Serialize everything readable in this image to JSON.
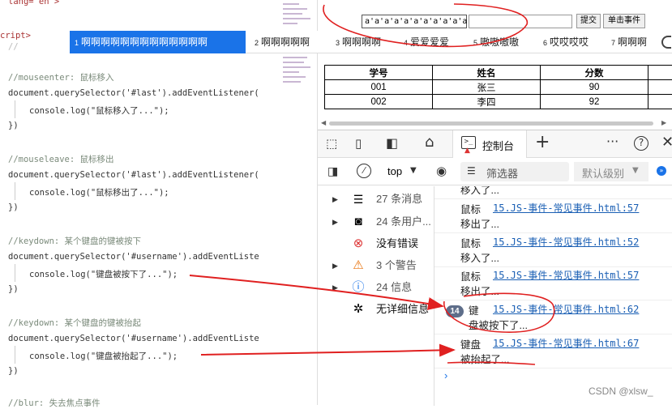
{
  "editor": {
    "lines": [
      {
        "text": "lang=\"en\">",
        "kind": "code"
      },
      {
        "text": "cript>",
        "kind": "tag"
      },
      {
        "text": "//mouseenter: 鼠标移入",
        "kind": "comment"
      },
      {
        "text": "document.querySelector('#last').addEventListener(",
        "kind": "code"
      },
      {
        "text": "console.log(\"鼠标移入了...\");",
        "kind": "code"
      },
      {
        "text": "})",
        "kind": "code"
      },
      {
        "text": "//mouseleave: 鼠标移出",
        "kind": "comment"
      },
      {
        "text": "document.querySelector('#last').addEventListener(",
        "kind": "code"
      },
      {
        "text": "console.log(\"鼠标移出了...\");",
        "kind": "code"
      },
      {
        "text": "})",
        "kind": "code"
      },
      {
        "text": "//keydown: 某个键盘的键被按下",
        "kind": "comment"
      },
      {
        "text": "document.querySelector('#username').addEventListe",
        "kind": "code"
      },
      {
        "text": "console.log(\"键盘被按下了...\");",
        "kind": "code"
      },
      {
        "text": "})",
        "kind": "code"
      },
      {
        "text": "//keydown: 某个键盘的键被抬起",
        "kind": "comment"
      },
      {
        "text": "document.querySelector('#username').addEventListe",
        "kind": "code"
      },
      {
        "text": "console.log(\"键盘被抬起了...\");",
        "kind": "code"
      },
      {
        "text": "})",
        "kind": "code"
      },
      {
        "text": "//blur: 失去焦点事件",
        "kind": "comment"
      }
    ]
  },
  "browser": {
    "input_value": "a'a'a'a'a'a'a'a'a'a'a'a'a'a",
    "submit_label": "提交",
    "click_label": "单击事件",
    "tabs": [
      {
        "num": "1",
        "label": "啊啊啊啊啊啊啊啊啊啊啊啊啊"
      },
      {
        "num": "2",
        "label": "啊啊啊啊啊"
      },
      {
        "num": "3",
        "label": "啊啊啊啊"
      },
      {
        "num": "4",
        "label": "爱爱爱爱"
      },
      {
        "num": "5",
        "label": "嗷嗷嗷嗷"
      },
      {
        "num": "6",
        "label": "哎哎哎哎"
      },
      {
        "num": "7",
        "label": "啊啊啊"
      }
    ],
    "table": {
      "headers": [
        "学号",
        "姓名",
        "分数"
      ],
      "rows": [
        [
          "001",
          "张三",
          "90"
        ],
        [
          "002",
          "李四",
          "92"
        ]
      ]
    }
  },
  "devtools": {
    "console_tab_label": "控制台",
    "context_label": "top",
    "filter_placeholder": "筛选器",
    "level_label": "默认级别",
    "sidebar": [
      {
        "icon": "list-icon",
        "label": "27 条消息",
        "expandable": true
      },
      {
        "icon": "user-icon",
        "label": "24 条用户...",
        "expandable": true
      },
      {
        "icon": "error-icon",
        "label": "没有错误",
        "expandable": false
      },
      {
        "icon": "warning-icon",
        "label": "3 个警告",
        "expandable": true
      },
      {
        "icon": "info-icon",
        "label": "24 信息",
        "expandable": true
      },
      {
        "icon": "bug-icon",
        "label": "无详细信息",
        "expandable": false
      }
    ],
    "messages": [
      {
        "t1": "",
        "link": "",
        "t2": "移入了..."
      },
      {
        "t1": "鼠标",
        "link": "15.JS-事件-常见事件.html:57",
        "t2": "移出了..."
      },
      {
        "t1": "鼠标",
        "link": "15.JS-事件-常见事件.html:52",
        "t2": "移入了..."
      },
      {
        "t1": "鼠标",
        "link": "15.JS-事件-常见事件.html:57",
        "t2": "移出了..."
      },
      {
        "t1": "键",
        "link": "15.JS-事件-常见事件.html:62",
        "t2": "盘被按下了...",
        "badge": "14"
      },
      {
        "t1": "键盘",
        "link": "15.JS-事件-常见事件.html:67",
        "t2": "被抬起了..."
      }
    ],
    "prompt": "›"
  },
  "watermark": "CSDN @xlsw_"
}
